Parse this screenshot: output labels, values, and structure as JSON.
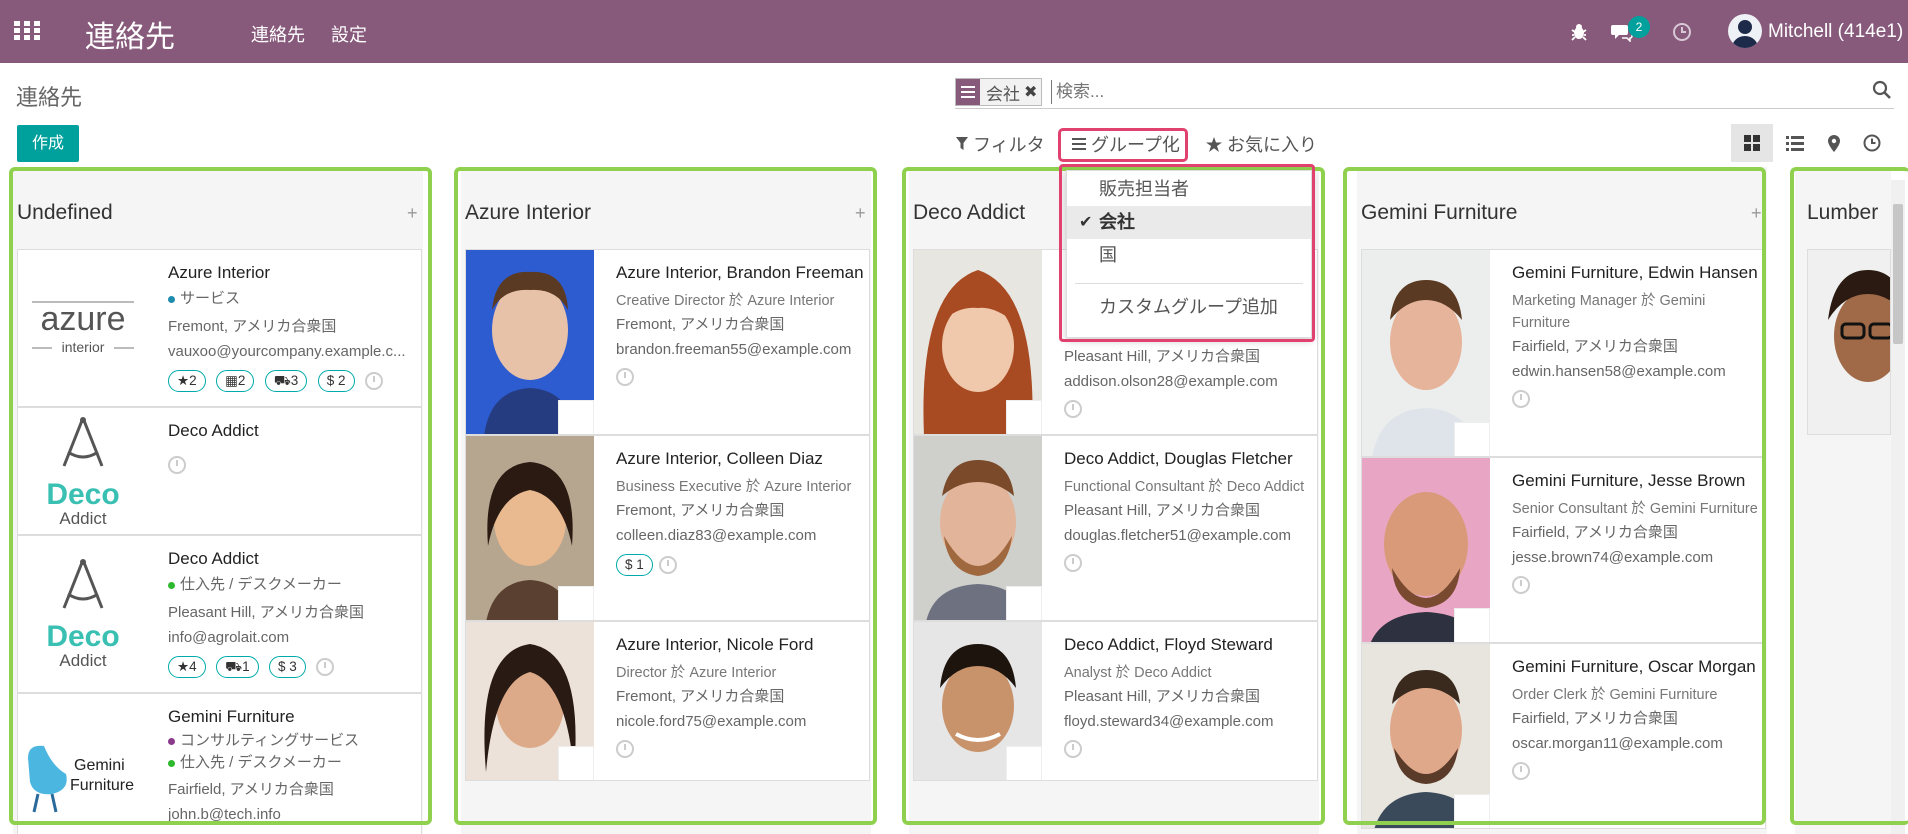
{
  "app": {
    "brand": "連絡先",
    "menu": [
      "連絡先",
      "設定"
    ],
    "user": "Mitchell (414e1)",
    "messages_badge": "2"
  },
  "page": {
    "breadcrumb": "連絡先"
  },
  "search": {
    "facet_value": "会社",
    "placeholder": "検索..."
  },
  "toolbar": {
    "create": "作成",
    "filters": "フィルタ",
    "groupby": "グループ化",
    "favorites": "お気に入り"
  },
  "groupby_menu": {
    "items": [
      "販売担当者",
      "会社",
      "国"
    ],
    "custom": "カスタムグループ追加"
  },
  "columns": [
    {
      "title": "Undefined",
      "cards": [
        {
          "name": "Azure Interior",
          "tags": [
            "サービス"
          ],
          "location": "Fremont, アメリカ合衆国",
          "email": "vauxoo@yourcompany.example.c...",
          "stats": [
            "2",
            "2",
            "3",
            "$ 2"
          ]
        },
        {
          "name": "Deco Addict"
        },
        {
          "name": "Deco Addict",
          "tags": [
            "仕入先 / デスクメーカー"
          ],
          "location": "Pleasant Hill, アメリカ合衆国",
          "email": "info@agrolait.com",
          "stats": [
            "4",
            "1",
            "$ 3"
          ]
        },
        {
          "name": "Gemini Furniture",
          "tags": [
            "コンサルティングサービス",
            "仕入先 / デスクメーカー"
          ],
          "location": "Fairfield, アメリカ合衆国",
          "email": "john.b@tech.info"
        }
      ]
    },
    {
      "title": "Azure Interior",
      "cards": [
        {
          "name": "Azure Interior, Brandon Freeman",
          "job": "Creative Director 於 Azure Interior",
          "location": "Fremont, アメリカ合衆国",
          "email": "brandon.freeman55@example.com"
        },
        {
          "name": "Azure Interior, Colleen Diaz",
          "job": "Business Executive 於 Azure Interior",
          "location": "Fremont, アメリカ合衆国",
          "email": "colleen.diaz83@example.com",
          "stats": [
            "$ 1"
          ]
        },
        {
          "name": "Azure Interior, Nicole Ford",
          "job": "Director 於 Azure Interior",
          "location": "Fremont, アメリカ合衆国",
          "email": "nicole.ford75@example.com"
        }
      ]
    },
    {
      "title": "Deco Addict",
      "cards": [
        {
          "name": "",
          "location": "Pleasant Hill, アメリカ合衆国",
          "email": "addison.olson28@example.com"
        },
        {
          "name": "Deco Addict, Douglas Fletcher",
          "job": "Functional Consultant 於 Deco Addict",
          "location": "Pleasant Hill, アメリカ合衆国",
          "email": "douglas.fletcher51@example.com"
        },
        {
          "name": "Deco Addict, Floyd Steward",
          "job": "Analyst 於 Deco Addict",
          "location": "Pleasant Hill, アメリカ合衆国",
          "email": "floyd.steward34@example.com"
        }
      ]
    },
    {
      "title": "Gemini Furniture",
      "cards": [
        {
          "name": "Gemini Furniture, Edwin Hansen",
          "job": "Marketing Manager 於 Gemini Furniture",
          "location": "Fairfield, アメリカ合衆国",
          "email": "edwin.hansen58@example.com"
        },
        {
          "name": "Gemini Furniture, Jesse Brown",
          "job": "Senior Consultant 於 Gemini Furniture",
          "location": "Fairfield, アメリカ合衆国",
          "email": "jesse.brown74@example.com"
        },
        {
          "name": "Gemini Furniture, Oscar Morgan",
          "job": "Order Clerk 於 Gemini Furniture",
          "location": "Fairfield, アメリカ合衆国",
          "email": "oscar.morgan11@example.com"
        }
      ]
    },
    {
      "title": "Lumber"
    }
  ],
  "logos": {
    "azure_1": "azure",
    "azure_2": "interior",
    "deco_1": "Deco",
    "deco_2": "Addict",
    "gemini_1": "Gemini",
    "gemini_2": "Furniture"
  },
  "colors": {
    "brand": "#875a7b",
    "accent": "#00a09d",
    "highlight": "#e0416f",
    "group_outline": "#8fd14f"
  }
}
